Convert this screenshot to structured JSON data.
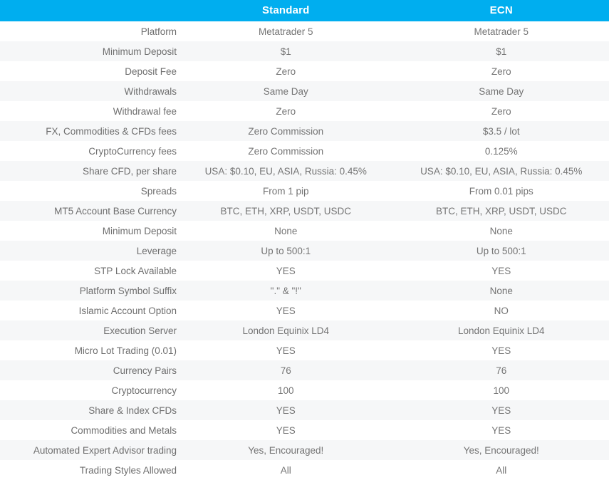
{
  "table": {
    "header": {
      "label_column": "",
      "columns": [
        "Standard",
        "ECN"
      ]
    },
    "accent_color": "#00AEEF",
    "header_text_color": "#FFFFFF",
    "row_stripe_color": "#F6F7F8",
    "text_color": "#6E6E6E",
    "rows": [
      {
        "label": "Platform",
        "standard": "Metatrader 5",
        "ecn": "Metatrader 5"
      },
      {
        "label": "Minimum Deposit",
        "standard": "$1",
        "ecn": "$1"
      },
      {
        "label": "Deposit Fee",
        "standard": "Zero",
        "ecn": "Zero"
      },
      {
        "label": "Withdrawals",
        "standard": "Same Day",
        "ecn": "Same Day"
      },
      {
        "label": "Withdrawal fee",
        "standard": "Zero",
        "ecn": "Zero"
      },
      {
        "label": "FX, Commodities & CFDs fees",
        "standard": "Zero Commission",
        "ecn": "$3.5 / lot"
      },
      {
        "label": "CryptoCurrency fees",
        "standard": "Zero Commission",
        "ecn": "0.125%"
      },
      {
        "label": "Share CFD, per share",
        "standard": "USA: $0.10, EU, ASIA, Russia: 0.45%",
        "ecn": "USA: $0.10, EU, ASIA, Russia: 0.45%"
      },
      {
        "label": "Spreads",
        "standard": "From 1 pip",
        "ecn": "From 0.01 pips"
      },
      {
        "label": "MT5 Account Base Currency",
        "standard": "BTC, ETH, XRP, USDT, USDC",
        "ecn": "BTC, ETH, XRP, USDT, USDC"
      },
      {
        "label": "Minimum Deposit",
        "standard": "None",
        "ecn": "None"
      },
      {
        "label": "Leverage",
        "standard": "Up to 500:1",
        "ecn": "Up to 500:1"
      },
      {
        "label": "STP Lock Available",
        "standard": "YES",
        "ecn": "YES"
      },
      {
        "label": "Platform Symbol Suffix",
        "standard": "\".\" & \"!\"",
        "ecn": "None"
      },
      {
        "label": "Islamic Account Option",
        "standard": "YES",
        "ecn": "NO"
      },
      {
        "label": "Execution Server",
        "standard": "London Equinix LD4",
        "ecn": "London Equinix LD4"
      },
      {
        "label": "Micro Lot Trading (0.01)",
        "standard": "YES",
        "ecn": "YES"
      },
      {
        "label": "Currency Pairs",
        "standard": "76",
        "ecn": "76"
      },
      {
        "label": "Cryptocurrency",
        "standard": "100",
        "ecn": "100"
      },
      {
        "label": "Share & Index CFDs",
        "standard": "YES",
        "ecn": "YES"
      },
      {
        "label": "Commodities and Metals",
        "standard": "YES",
        "ecn": "YES"
      },
      {
        "label": "Automated Expert Advisor trading",
        "standard": "Yes, Encouraged!",
        "ecn": "Yes, Encouraged!"
      },
      {
        "label": "Trading Styles Allowed",
        "standard": "All",
        "ecn": "All"
      }
    ]
  }
}
